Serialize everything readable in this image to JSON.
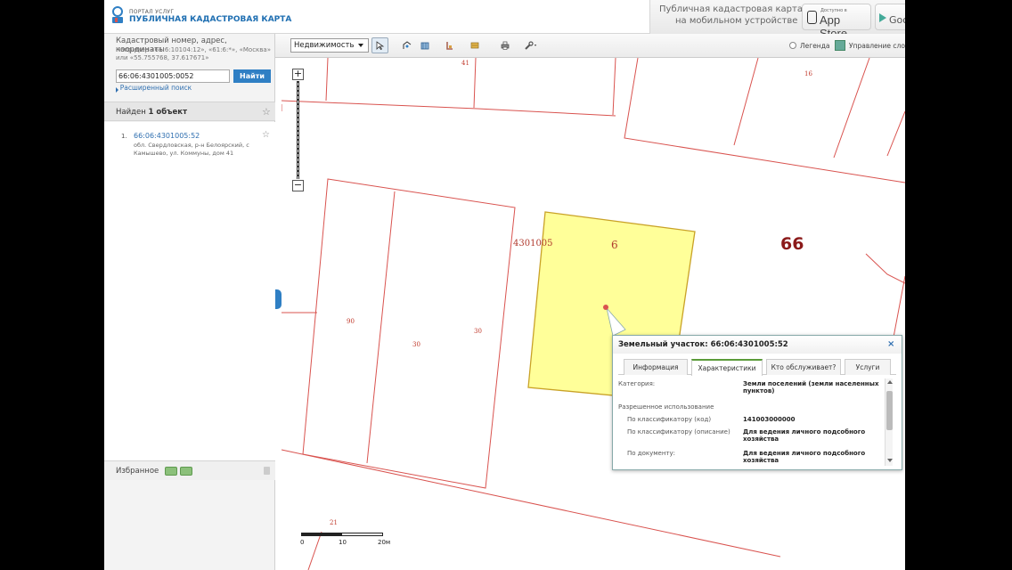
{
  "header": {
    "logo_small": "ПОРТАЛ УСЛУГ",
    "logo_main": "ПУБЛИЧНАЯ КАДАСТРОВАЯ КАРТА",
    "promo_line1": "Публичная кадастровая карта",
    "promo_line2": "на мобильном устройстве",
    "appstore_small": "Доступно в",
    "appstore_big": "App Store",
    "gplay_big": "Goo"
  },
  "sidebar": {
    "search_label": "Кадастровый номер, адрес, координаты",
    "search_hint": "Например «61:6:10104:12», «61:6:*», «Москва» или «55.755768, 37.617671»",
    "search_value": "66:06:4301005:0052",
    "search_button": "Найти",
    "advanced_search": "Расширенный поиск",
    "found_prefix": "Найден",
    "found_count": "1 объект",
    "result": {
      "number": "1.",
      "cadastral": "66:06:4301005:52",
      "address": "обл. Свердловская, р-н Белоярский, с Камышево, ул. Коммуны, дом 41"
    },
    "favorites_label": "Избранное"
  },
  "toolbar": {
    "layer_select": "Недвижимость",
    "legend_label": "Легенда",
    "layers_label": "Управление слоями"
  },
  "map": {
    "plot_labels": [
      "41",
      "16",
      "90",
      "30",
      "30",
      "21"
    ],
    "quarter_label": "4301005",
    "parcel_number": "6",
    "district_label": "66",
    "colors": {
      "boundary": "#d9534f",
      "parcel_fill": "#ffff99",
      "parcel_stroke": "#c9a227",
      "district_text": "#8b1a1a"
    },
    "scale": [
      "0",
      "10",
      "20м"
    ]
  },
  "popup": {
    "title": "Земельный участок: 66:06:4301005:52",
    "tabs": [
      "Информация",
      "Характеристики",
      "Кто обслуживает?",
      "Услуги"
    ],
    "active_tab": "Характеристики",
    "rows": [
      {
        "label": "Категория:",
        "value": "Земли поселений (земли населенных пунктов)"
      },
      {
        "label": "Разрешенное использование",
        "value": ""
      },
      {
        "label": "По классификатору (код)",
        "value": "141003000000"
      },
      {
        "label": "По классификатору (описание)",
        "value": "Для ведения личного подсобного хозяйства"
      },
      {
        "label": "По документу:",
        "value": "Для ведения личного подсобного хозяйства"
      }
    ]
  }
}
